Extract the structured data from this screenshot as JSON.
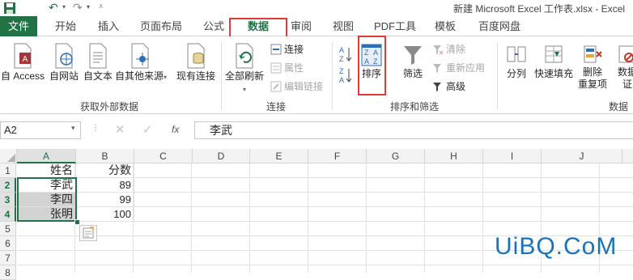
{
  "window": {
    "title": "新建 Microsoft Excel 工作表.xlsx - Excel"
  },
  "quick_access": {
    "save_icon": "save-icon",
    "undo_icon": "undo-icon",
    "redo_icon": "redo-icon"
  },
  "tabs": [
    {
      "label": "文件"
    },
    {
      "label": "开始"
    },
    {
      "label": "插入"
    },
    {
      "label": "页面布局"
    },
    {
      "label": "公式"
    },
    {
      "label": "数据"
    },
    {
      "label": "审阅"
    },
    {
      "label": "视图"
    },
    {
      "label": "PDF工具"
    },
    {
      "label": "模板"
    },
    {
      "label": "百度网盘"
    }
  ],
  "ribbon": {
    "get_external": {
      "label": "获取外部数据",
      "buttons": [
        {
          "label": "自 Access"
        },
        {
          "label": "自网站"
        },
        {
          "label": "自文本"
        },
        {
          "label": "自其他来源"
        },
        {
          "label": "现有连接"
        }
      ]
    },
    "connections": {
      "label": "连接",
      "refresh_all": "全部刷新",
      "items": [
        {
          "label": "连接"
        },
        {
          "label": "属性"
        },
        {
          "label": "编辑链接"
        }
      ]
    },
    "sort_filter": {
      "label": "排序和筛选",
      "sort_az_icon": "sort-ascending-icon",
      "sort_za_icon": "sort-descending-icon",
      "sort": "排序",
      "filter": "筛选",
      "items": [
        {
          "label": "清除"
        },
        {
          "label": "重新应用"
        },
        {
          "label": "高级"
        }
      ]
    },
    "data_tools": {
      "label": "数据",
      "buttons": [
        {
          "label": "分列"
        },
        {
          "label": "快速填充"
        },
        {
          "label": "删除",
          "label2": "重复项"
        },
        {
          "label": "数据",
          "label2": "证"
        }
      ]
    }
  },
  "formula_bar": {
    "name_box": "A2",
    "cancel": "✕",
    "enter": "✓",
    "fx": "fx",
    "content": "李武"
  },
  "sheet": {
    "columns": [
      "A",
      "B",
      "C",
      "D",
      "E",
      "F",
      "G",
      "H",
      "I",
      "J"
    ],
    "rows": [
      "1",
      "2",
      "3",
      "4",
      "5",
      "6",
      "7",
      "8",
      "9"
    ],
    "cells": {
      "A1": "姓名",
      "B1": "分数",
      "A2": "李武",
      "B2": "89",
      "A3": "李四",
      "B3": "99",
      "A4": "张明",
      "B4": "100"
    },
    "active_cell": "A2"
  },
  "watermark": "UiBQ.CoM",
  "colors": {
    "excel_green": "#217346",
    "highlight_red": "#e03a3a",
    "selection_gray": "#d3d3d3"
  }
}
